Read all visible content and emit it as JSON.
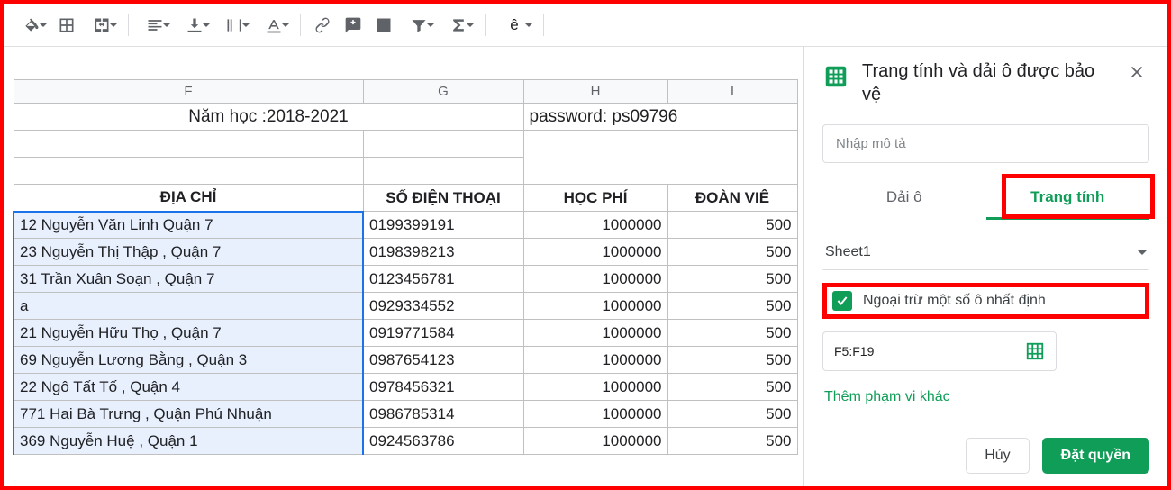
{
  "toolbar": {
    "fill_icon": "paint-bucket",
    "borders_icon": "borders",
    "merge_icon": "merge-cells",
    "halign_icon": "align-left",
    "valign_icon": "valign-bottom",
    "wrap_icon": "text-wrap",
    "rotate_icon": "text-rotate",
    "link_icon": "insert-link",
    "comment_icon": "add-comment",
    "chart_icon": "insert-chart",
    "filter_icon": "create-filter",
    "functions_icon": "functions",
    "input_tools_label": "ê"
  },
  "columns": {
    "F": "F",
    "G": "G",
    "H": "H",
    "I": "I"
  },
  "merged": {
    "year_label": "Năm học :2018-2021",
    "password_label": "password: ps09796"
  },
  "headers": {
    "address": "ĐỊA CHỈ",
    "phone": "SỐ ĐIỆN THOẠI",
    "fee": "HỌC PHÍ",
    "member": "ĐOÀN VIÊ"
  },
  "rows": [
    {
      "address": "12 Nguyễn Văn Linh Quận 7",
      "phone": "0199399191",
      "fee": "1000000",
      "member": "500"
    },
    {
      "address": "23 Nguyễn Thị Thập , Quận 7",
      "phone": "0198398213",
      "fee": "1000000",
      "member": "500"
    },
    {
      "address": "31 Trần Xuân Soạn , Quận 7",
      "phone": "0123456781",
      "fee": "1000000",
      "member": "500"
    },
    {
      "address": "a",
      "phone": "0929334552",
      "fee": "1000000",
      "member": "500"
    },
    {
      "address": "21 Nguyễn Hữu Thọ , Quận 7",
      "phone": "0919771584",
      "fee": "1000000",
      "member": "500"
    },
    {
      "address": "69 Nguyễn Lương Bằng , Quận 3",
      "phone": "0987654123",
      "fee": "1000000",
      "member": "500"
    },
    {
      "address": "22 Ngô Tất Tố , Quận 4",
      "phone": "0978456321",
      "fee": "1000000",
      "member": "500"
    },
    {
      "address": "771 Hai Bà Trưng , Quận Phú Nhuận",
      "phone": "0986785314",
      "fee": "1000000",
      "member": "500"
    },
    {
      "address": "369 Nguyễn Huệ , Quận 1",
      "phone": "0924563786",
      "fee": "1000000",
      "member": "500"
    }
  ],
  "sidebar": {
    "title": "Trang tính và dải ô được bảo vệ",
    "desc_placeholder": "Nhập mô tả",
    "tab_range": "Dải ô",
    "tab_sheet": "Trang tính",
    "sheet_selected": "Sheet1",
    "except_label": "Ngoại trừ một số ô nhất định",
    "range_value": "F5:F19",
    "add_range": "Thêm phạm vi khác",
    "cancel": "Hủy",
    "set_perm": "Đặt quyền"
  }
}
